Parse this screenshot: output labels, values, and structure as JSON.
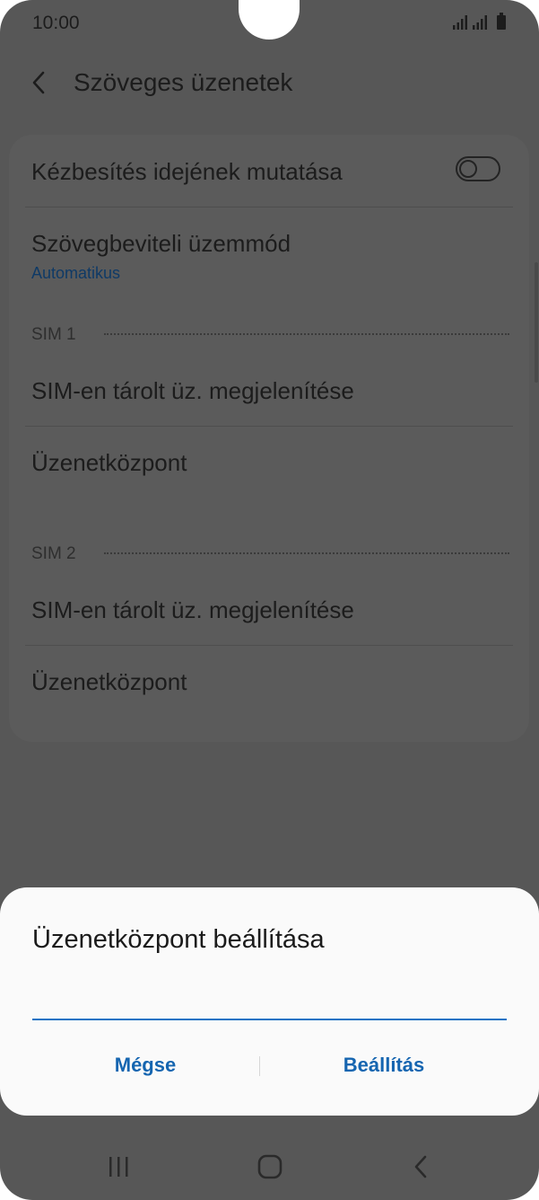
{
  "status_bar": {
    "time": "10:00"
  },
  "header": {
    "title": "Szöveges üzenetek"
  },
  "settings": {
    "delivery_time": {
      "label": "Kézbesítés idejének mutatása",
      "enabled": false
    },
    "input_mode": {
      "label": "Szövegbeviteli üzemmód",
      "value": "Automatikus"
    },
    "sim1": {
      "header": "SIM 1",
      "show_messages": "SIM-en tárolt üz. megjelenítése",
      "message_center": "Üzenetközpont"
    },
    "sim2": {
      "header": "SIM 2",
      "show_messages": "SIM-en tárolt üz. megjelenítése",
      "message_center": "Üzenetközpont"
    }
  },
  "dialog": {
    "title": "Üzenetközpont beállítása",
    "input_value": "",
    "cancel_label": "Mégse",
    "confirm_label": "Beállítás"
  },
  "nav_bar": {
    "icons": [
      "recent-apps-icon",
      "home-icon",
      "back-icon"
    ]
  },
  "colors": {
    "accent": "#1565b0",
    "input_underline": "#1a73c4",
    "subtitle": "#0f3a66",
    "dim_background": "#575757",
    "dialog_background": "#fafafa"
  }
}
